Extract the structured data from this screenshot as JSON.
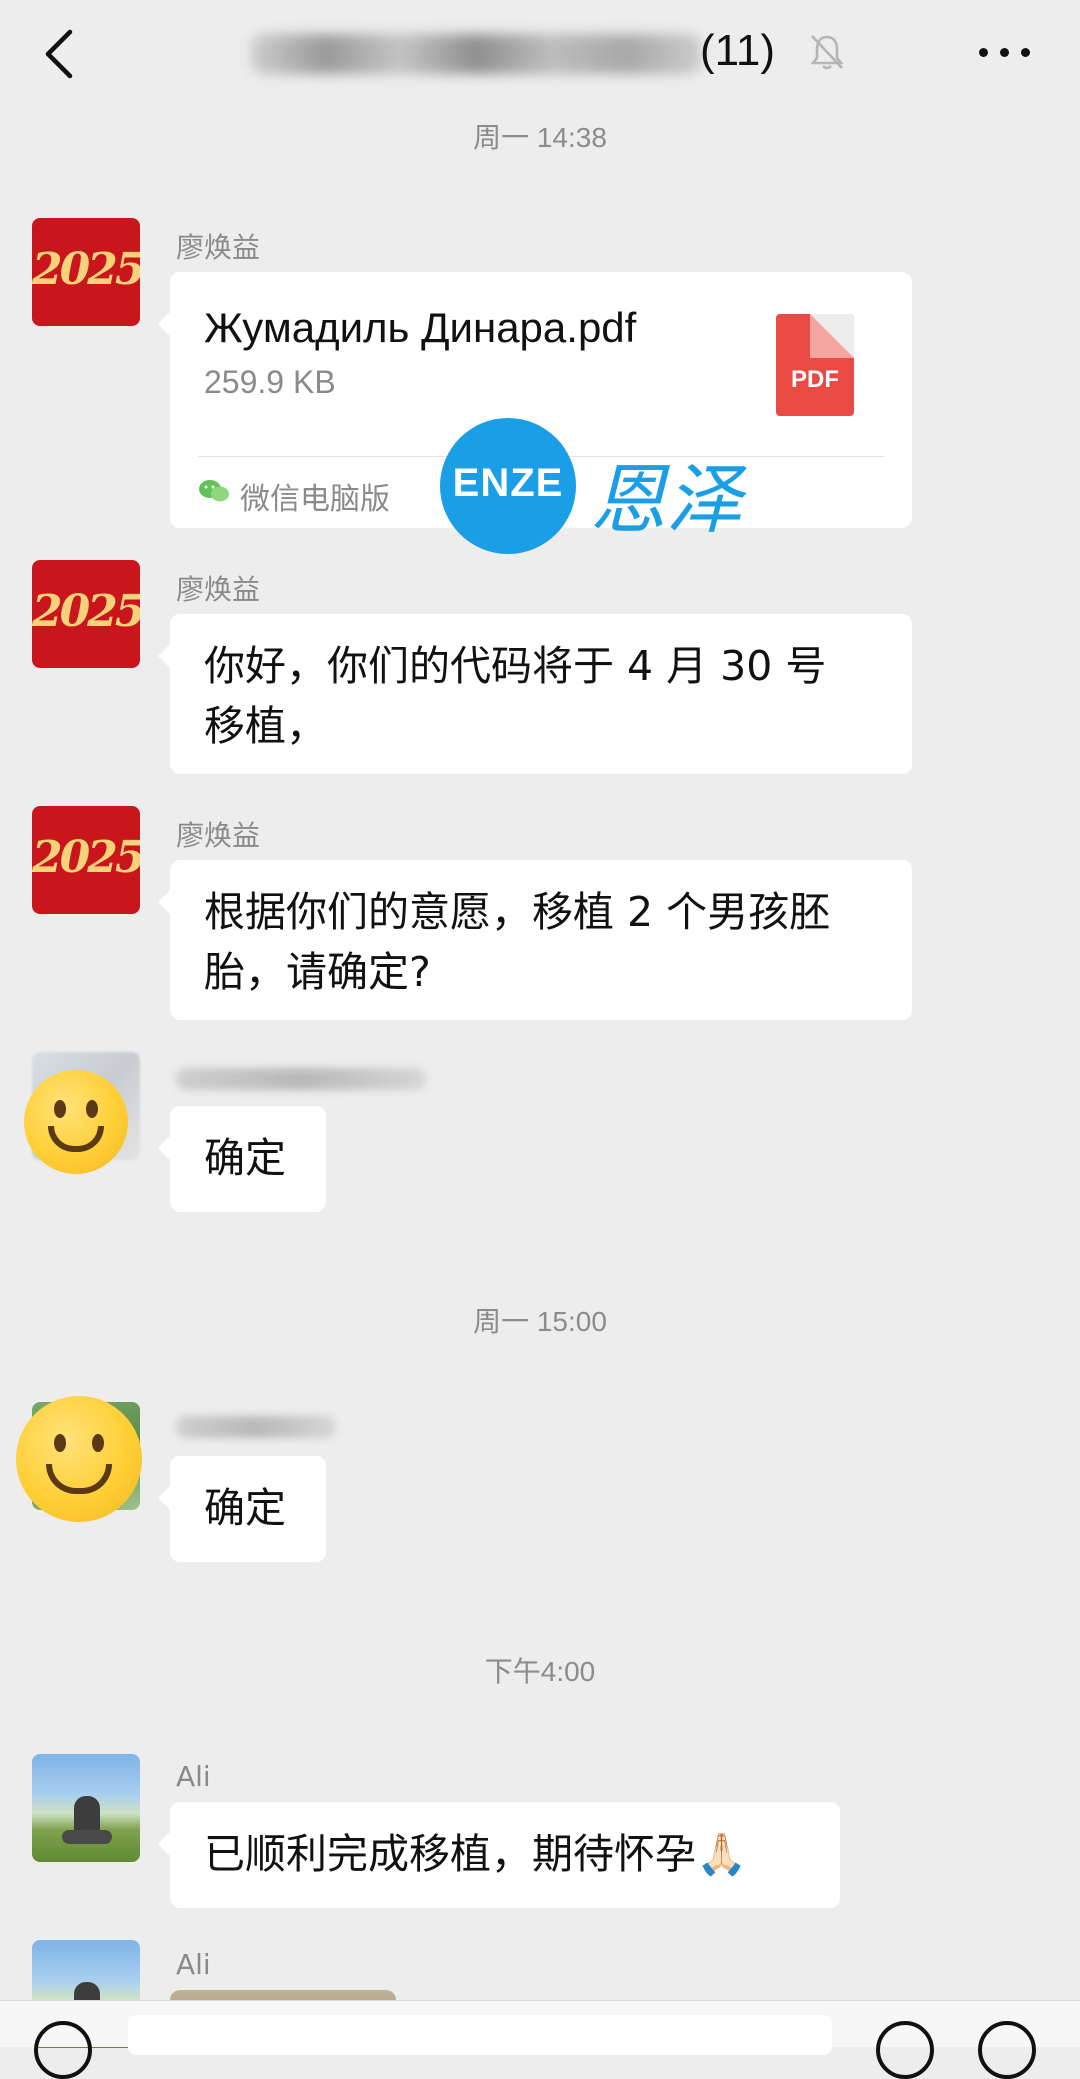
{
  "header": {
    "title_count": "(11)",
    "title_blurred": true
  },
  "timestamps": {
    "t1": "周一 14:38",
    "t2": "周一 15:00",
    "t3": "下午4:00"
  },
  "messages": [
    {
      "sender": "廖焕益",
      "type": "file",
      "file": {
        "name": "Жумадиль Динара.pdf",
        "size": "259.9 KB",
        "icon_label": "PDF",
        "source": "微信电脑版"
      }
    },
    {
      "sender": "廖焕益",
      "type": "text",
      "lines": [
        "你好，你们的代码将于 4 月 30 号",
        "移植，"
      ]
    },
    {
      "sender": "廖焕益",
      "type": "text",
      "lines": [
        "根据你们的意愿，移植 2 个男孩胚",
        "胎，请确定?"
      ]
    },
    {
      "sender": "",
      "type": "text",
      "lines": [
        "确定"
      ]
    },
    {
      "sender": "",
      "type": "text",
      "lines": [
        "确定"
      ]
    },
    {
      "sender": "Ali",
      "type": "text",
      "lines": [
        "已顺利完成移植，期待怀孕🙏🏻"
      ]
    },
    {
      "sender": "Ali",
      "type": "image"
    }
  ],
  "avatars": {
    "staff_logo_text": "2025."
  },
  "watermark": {
    "badge": "ENZE",
    "text": "恩泽"
  },
  "colors": {
    "background": "#ededed",
    "bubble": "#ffffff",
    "pdf_red": "#e94a44",
    "watermark_blue": "#1a9ee6",
    "avatar_red": "#c8161c"
  }
}
